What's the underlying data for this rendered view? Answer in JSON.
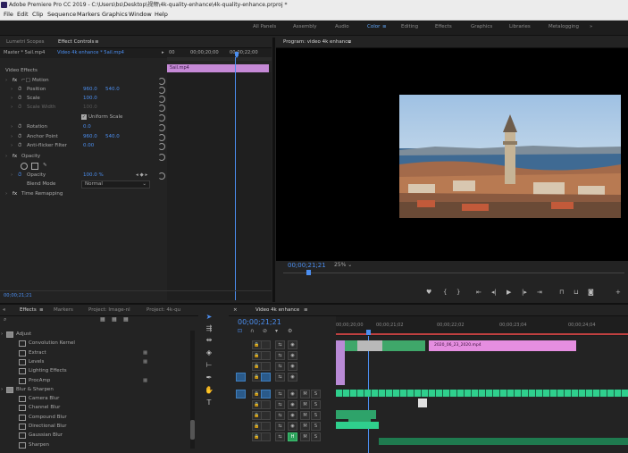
{
  "window": {
    "title": "Adobe Premiere Pro CC 2019 - C:\\Users\\bs\\Desktop\\视频\\4k-quality-enhance\\4k-quality-enhance.prproj *"
  },
  "menu": [
    "File",
    "Edit",
    "Clip",
    "Sequence",
    "Markers",
    "Graphics",
    "Window",
    "Help"
  ],
  "workspaces": [
    "All Panels",
    "Assembly",
    "Audio",
    "Color",
    "Editing",
    "Effects",
    "Graphics",
    "Libraries",
    "Metalogging"
  ],
  "active_workspace": "Color",
  "effect_controls": {
    "tabs": [
      "Lumetri Scopes",
      "Effect Controls"
    ],
    "master": "Master * 5ail.mp4",
    "clip": "Video 4k enhance * 5ail.mp4",
    "ruler_start": "00",
    "ruler_mid": "00;00;20;00",
    "ruler_end": "00;00;22;00",
    "clip_label": "5ail.mp4",
    "section_video": "Video Effects",
    "motion": "Motion",
    "position_label": "Position",
    "position_x": "960.0",
    "position_y": "540.0",
    "scale_label": "Scale",
    "scale_value": "100.0",
    "scale_width_label": "Scale Width",
    "uniform_scale": "Uniform Scale",
    "rotation_label": "Rotation",
    "rotation_value": "0.0",
    "anchor_label": "Anchor Point",
    "anchor_x": "960.0",
    "anchor_y": "540.0",
    "flicker_label": "Anti-flicker Filter",
    "flicker_value": "0.00",
    "opacity_section": "Opacity",
    "opacity_label": "Opacity",
    "opacity_value": "100.0 %",
    "blend_label": "Blend Mode",
    "blend_value": "Normal",
    "time_remap": "Time Remapping",
    "bottom_time": "00;00;21;21"
  },
  "program_monitor": {
    "title": "Program: video 4k enhance",
    "timecode": "00;00;21;21",
    "zoom": "25%"
  },
  "effects_panel": {
    "tabs": [
      "Effects",
      "Markers",
      "Project: Image-nl",
      "Project: 4k-qu"
    ],
    "items": [
      {
        "label": "Adjust",
        "folder": true,
        "indent": 1
      },
      {
        "label": "Convolution Kernel",
        "indent": 2
      },
      {
        "label": "Extract",
        "indent": 2
      },
      {
        "label": "Levels",
        "indent": 2
      },
      {
        "label": "Lighting Effects",
        "indent": 2
      },
      {
        "label": "ProcAmp",
        "indent": 2
      },
      {
        "label": "Blur & Sharpen",
        "folder": true,
        "indent": 1
      },
      {
        "label": "Camera Blur",
        "indent": 2
      },
      {
        "label": "Channel Blur",
        "indent": 2
      },
      {
        "label": "Compound Blur",
        "indent": 2
      },
      {
        "label": "Directional Blur",
        "indent": 2
      },
      {
        "label": "Gaussian Blur",
        "indent": 2
      },
      {
        "label": "Sharpen",
        "indent": 2
      }
    ]
  },
  "timeline": {
    "tab": "Video 4k enhance",
    "timecode": "00;00;21;21",
    "ruler": [
      "00;00;20;00",
      "00;00;21;02",
      "00;00;22;02",
      "00;00;23;04",
      "00;00;24;04"
    ],
    "clip_name": "2020_06_23_2020.mp4",
    "track_labels": [
      "V4",
      "V3",
      "V2",
      "V1",
      "A1",
      "A2",
      "A3"
    ],
    "v1_label": "V1"
  }
}
